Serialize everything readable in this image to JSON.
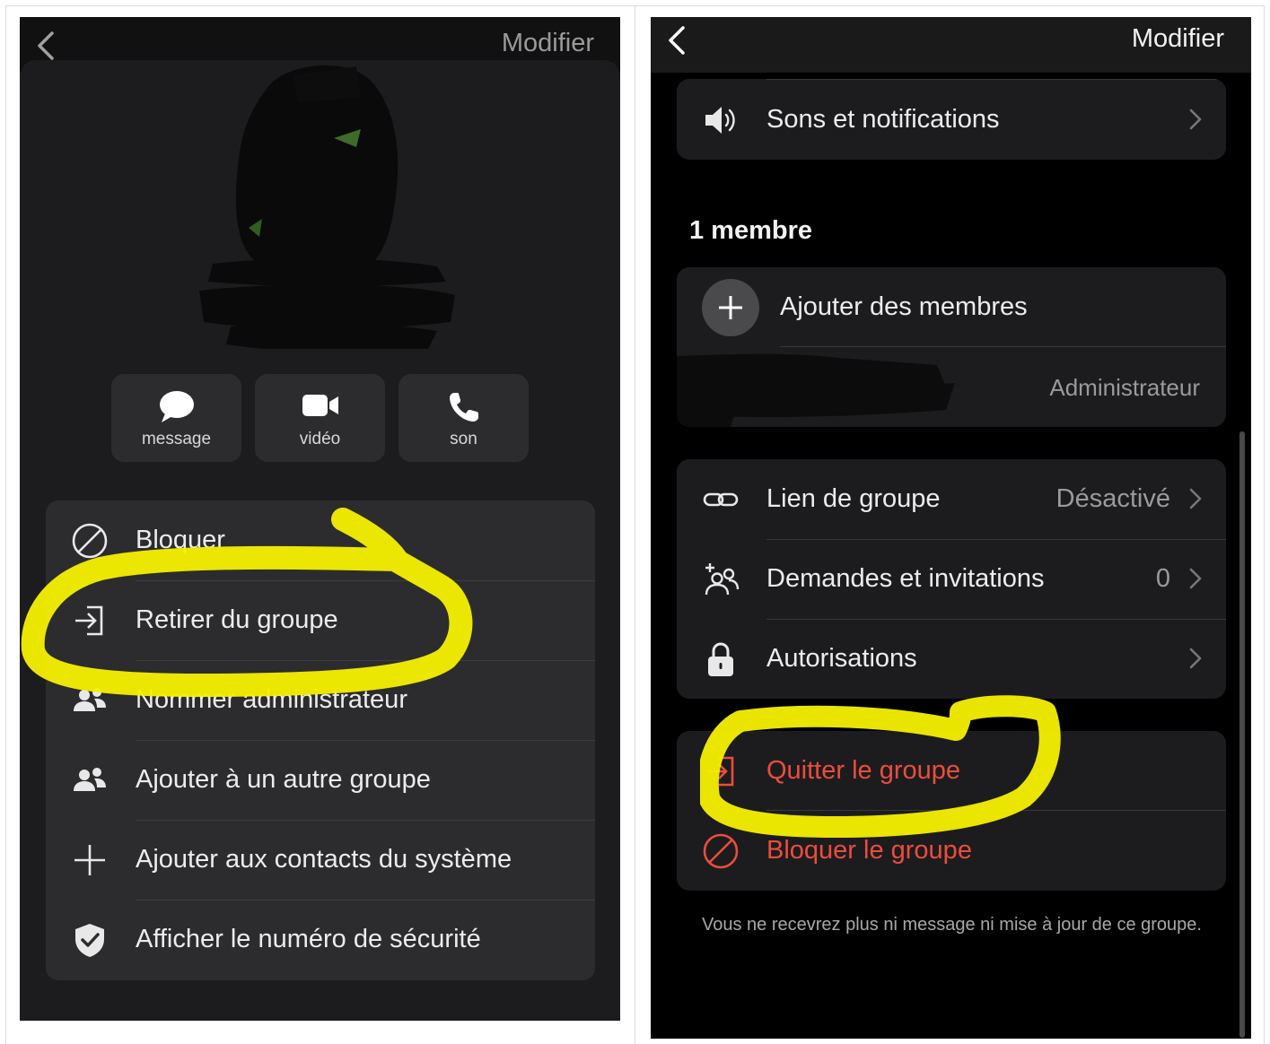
{
  "left": {
    "edit_label": "Modifier",
    "actions": [
      {
        "label": "message",
        "icon": "chat-bubble-icon"
      },
      {
        "label": "vidéo",
        "icon": "video-camera-icon"
      },
      {
        "label": "son",
        "icon": "phone-icon"
      }
    ],
    "menu": [
      {
        "label": "Bloquer",
        "icon": "block-icon"
      },
      {
        "label": "Retirer du groupe",
        "icon": "remove-from-group-icon"
      },
      {
        "label": "Nommer administrateur",
        "icon": "people-icon"
      },
      {
        "label": "Ajouter à un autre groupe",
        "icon": "people-icon"
      },
      {
        "label": "Ajouter aux contacts du système",
        "icon": "plus-icon"
      },
      {
        "label": "Afficher le numéro de sécurité",
        "icon": "shield-check-icon"
      }
    ]
  },
  "right": {
    "edit_label": "Modifier",
    "sounds_label": "Sons et notifications",
    "members_title": "1 membre",
    "add_members_label": "Ajouter des membres",
    "admin_label": "Administrateur",
    "group_link": {
      "label": "Lien de groupe",
      "value": "Désactivé"
    },
    "requests": {
      "label": "Demandes et invitations",
      "value": "0"
    },
    "permissions_label": "Autorisations",
    "leave_label": "Quitter le groupe",
    "block_group_label": "Bloquer le groupe",
    "footnote": "Vous ne recevrez plus ni message ni mise à jour de ce groupe."
  },
  "colors": {
    "destructive": "#eb4d3d",
    "highlight": "#f5f000",
    "card": "#1c1c1e"
  }
}
